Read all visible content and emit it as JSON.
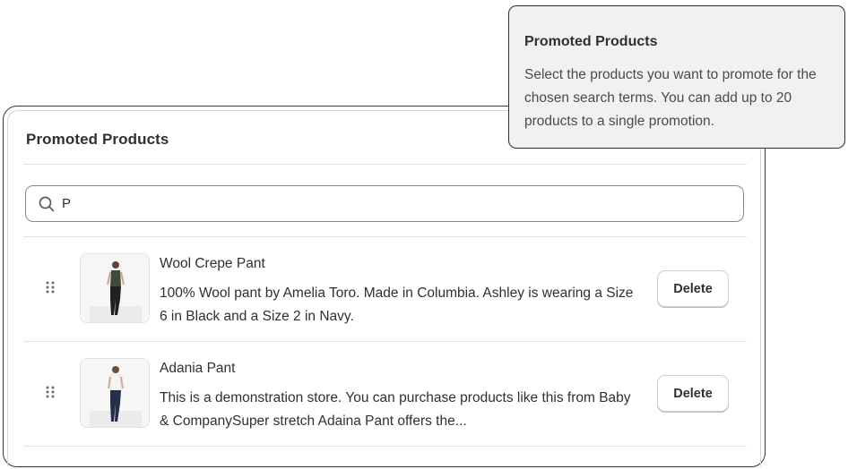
{
  "card": {
    "title": "Promoted Products"
  },
  "search": {
    "value": "P",
    "icon": "search-icon"
  },
  "products": [
    {
      "title": "Wool Crepe Pant",
      "description": "100% Wool pant by Amelia Toro. Made in Columbia. Ashley is wearing a Size 6 in Black and a Size 2 in Navy.",
      "delete_label": "Delete"
    },
    {
      "title": "Adania Pant",
      "description": "This is a demonstration store. You can purchase products like this from Baby & CompanySuper stretch Adaina Pant offers the...",
      "delete_label": "Delete"
    }
  ],
  "tooltip": {
    "title": "Promoted Products",
    "body": "Select the products you want to promote for the chosen search terms. You can add up to 20 products to a single promotion."
  },
  "colors": {
    "text": "#303030",
    "border": "#3a3a3a",
    "tooltip_bg": "#f1f1f1"
  }
}
